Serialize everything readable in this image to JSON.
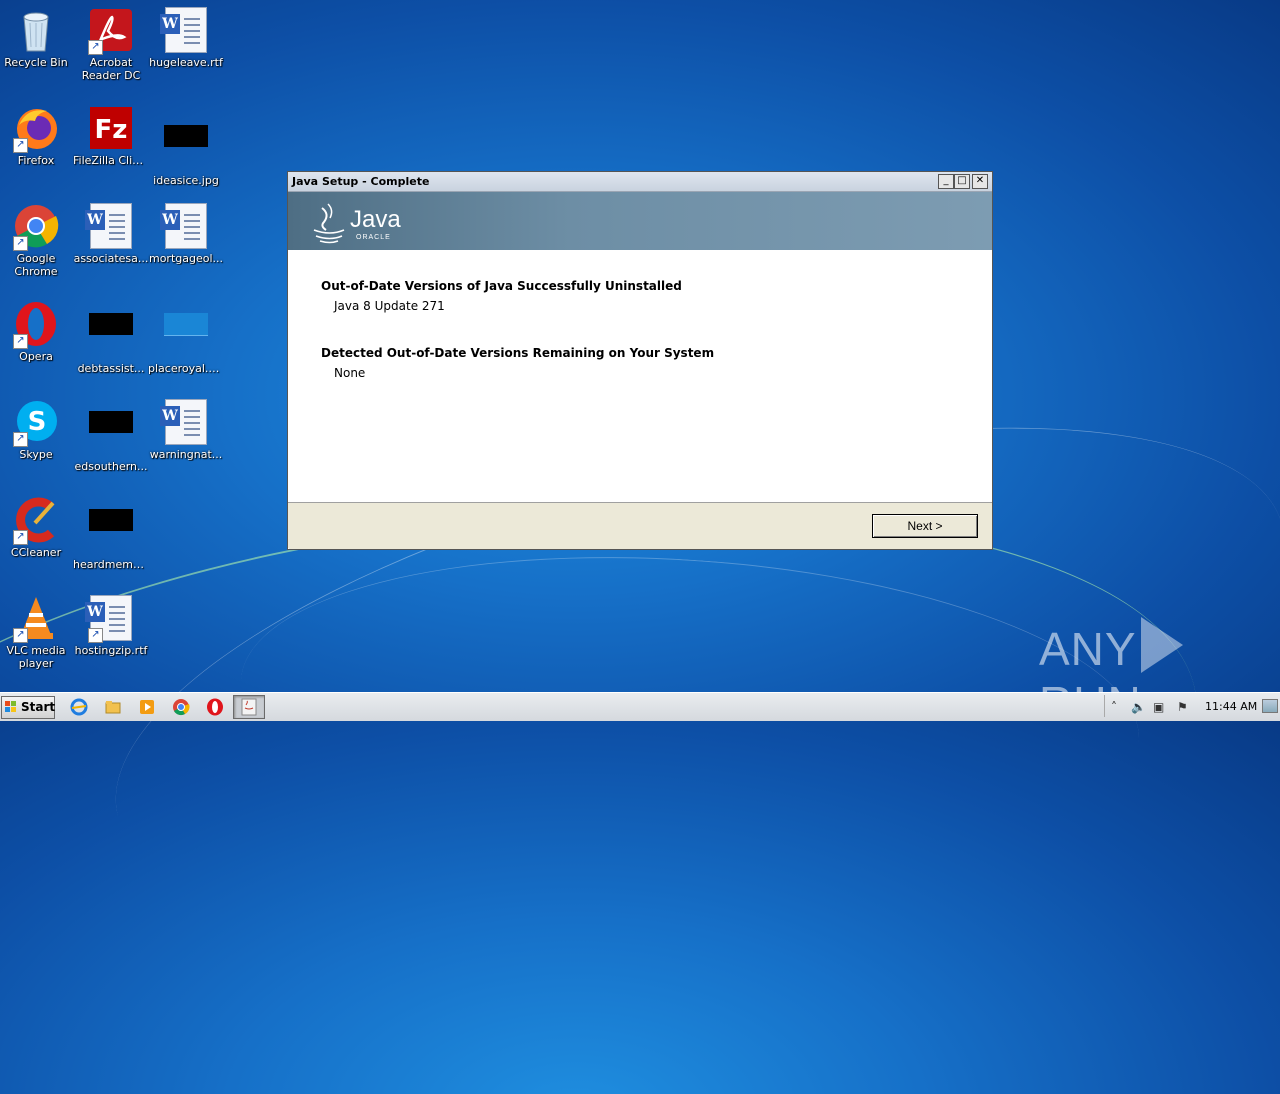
{
  "desktop": {
    "icons": [
      {
        "label": "Recycle Bin"
      },
      {
        "label": "Acrobat Reader DC"
      },
      {
        "label": "hugeleave.rtf"
      },
      {
        "label": "Firefox"
      },
      {
        "label": "FileZilla Client"
      },
      {
        "label": "ideasice.jpg"
      },
      {
        "label": "Google Chrome"
      },
      {
        "label": "associatesa..."
      },
      {
        "label": "mortgageol..."
      },
      {
        "label": "Opera"
      },
      {
        "label": "debtassist..."
      },
      {
        "label": "placeroyal.png"
      },
      {
        "label": "Skype"
      },
      {
        "label": "edsouthern..."
      },
      {
        "label": "warningnat..."
      },
      {
        "label": "CCleaner"
      },
      {
        "label": "heardmemb..."
      },
      {
        "label": "VLC media player"
      },
      {
        "label": "hostingzip.rtf"
      }
    ]
  },
  "window": {
    "title": "Java Setup - Complete",
    "logo_text": "Java",
    "logo_sub": "ORACLE",
    "section1_heading": "Out-of-Date Versions of Java Successfully Uninstalled",
    "section1_value": "Java 8 Update 271",
    "section2_heading": "Detected Out-of-Date Versions Remaining on Your System",
    "section2_value": "None",
    "next_label": "Next >",
    "min_glyph": "_",
    "max_glyph": "□",
    "close_glyph": "✕"
  },
  "taskbar": {
    "start_label": "Start",
    "clock": "11:44 AM"
  },
  "watermark": {
    "left": "ANY",
    "right": "RUN"
  },
  "colors": {
    "banner": "#5b7d94",
    "desktop": "#1670c8"
  }
}
